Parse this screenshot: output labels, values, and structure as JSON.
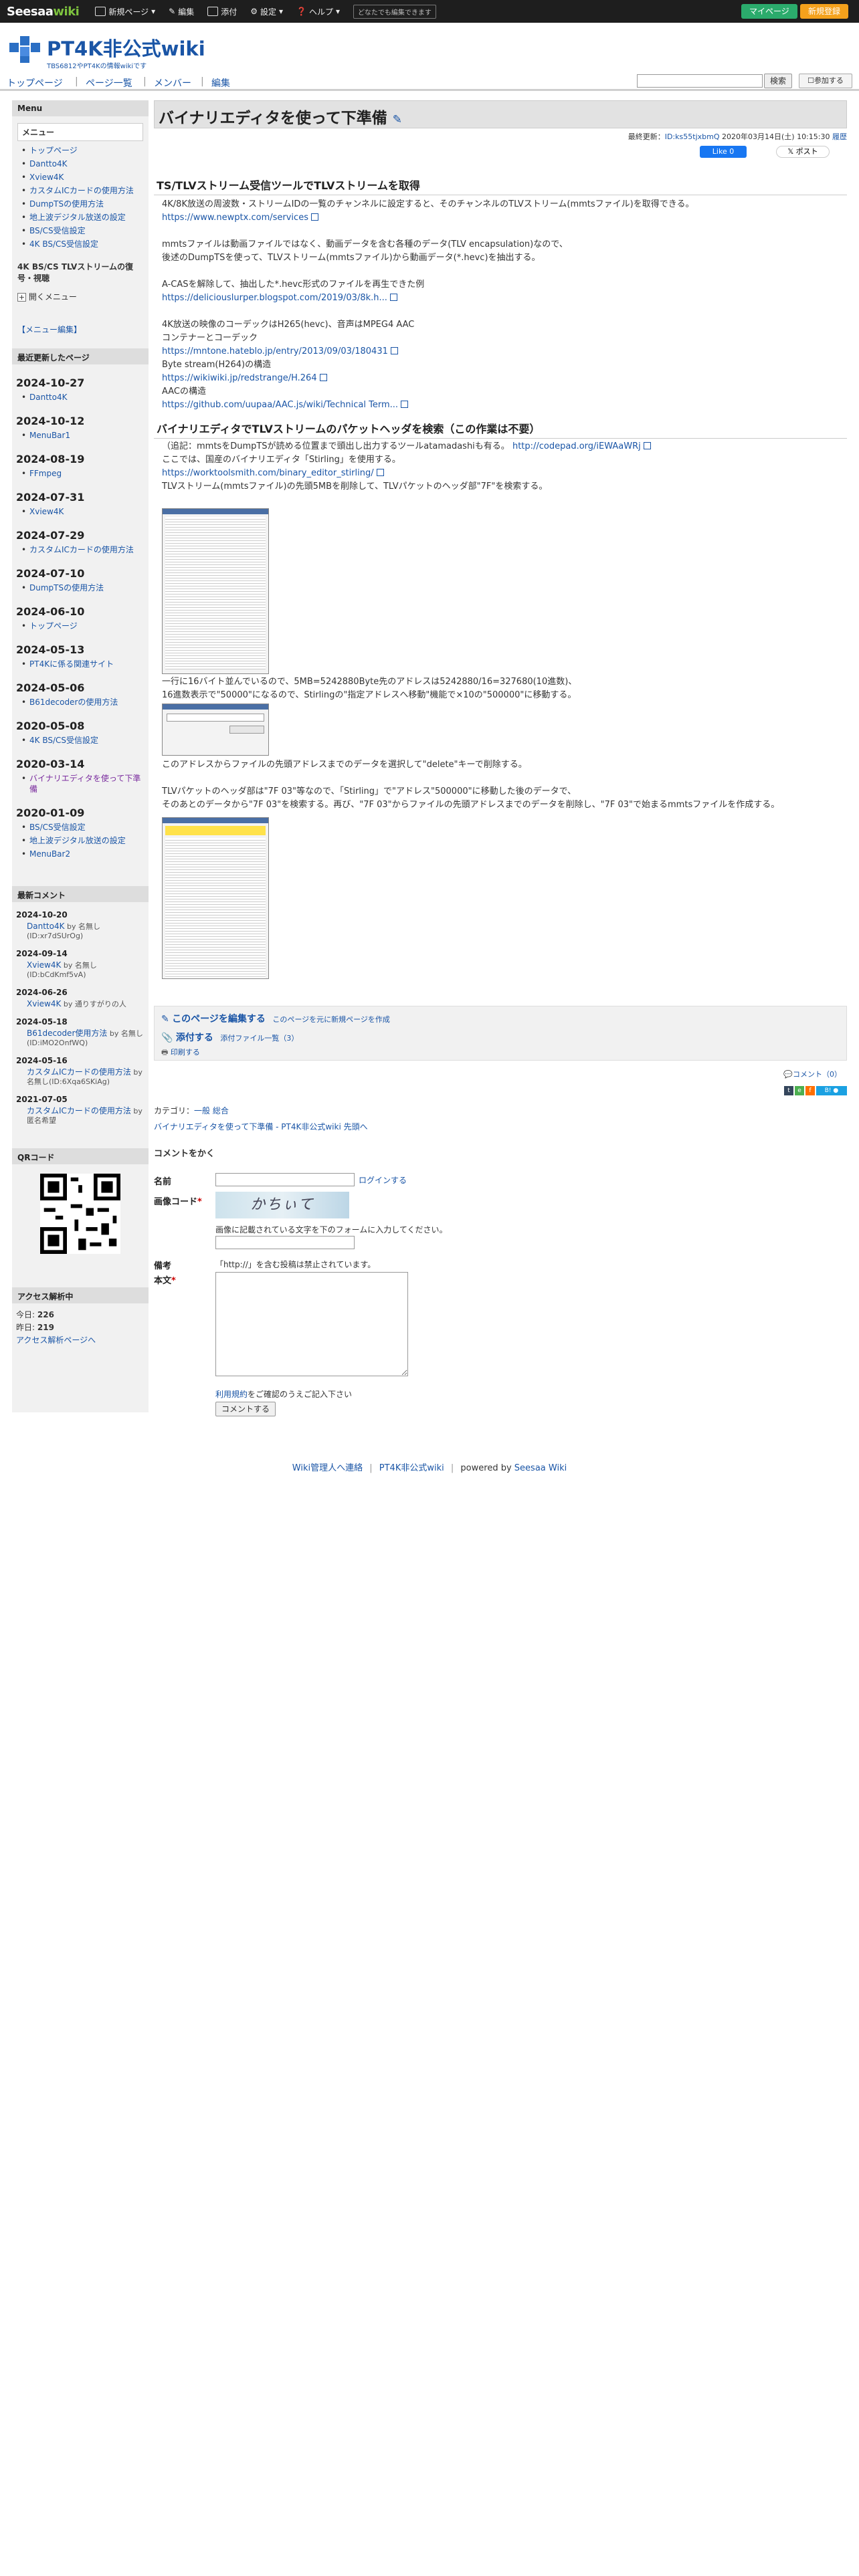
{
  "topbar": {
    "logo_a": "Seesaa",
    "logo_b": "wiki",
    "new_page": "新規ページ",
    "edit": "編集",
    "attach": "添付",
    "settings": "設定",
    "help": "ヘルプ",
    "note": "どなたでも編集できます",
    "mypage": "マイページ",
    "new_reg": "新規登録"
  },
  "site": {
    "name": "PT4K非公式wiki",
    "desc": "TBS6812やPT4Kの情報wikiです"
  },
  "gnav": {
    "top": "トップページ",
    "list": "ページ一覧",
    "member": "メンバー",
    "edit": "編集",
    "search_btn": "検索",
    "join_btn": "参加する"
  },
  "sidebar": {
    "menu_heading": "Menu",
    "menu_title": "メニュー",
    "menu_items": [
      "トップページ",
      "Dantto4K",
      "Xview4K",
      "カスタムICカードの使用方法",
      "DumpTSの使用方法",
      "地上波デジタル放送の設定",
      "BS/CS受信設定",
      "4K BS/CS受信設定"
    ],
    "sub_heading": "4K BS/CS TLVストリームの復号・視聴",
    "open_menu": "開くメニュー",
    "menu_edit": "【メニュー編集】",
    "recent_heading": "最近更新したページ",
    "recent": [
      {
        "date": "2024-10-27",
        "items": [
          "Dantto4K"
        ]
      },
      {
        "date": "2024-10-12",
        "items": [
          "MenuBar1"
        ]
      },
      {
        "date": "2024-08-19",
        "items": [
          "FFmpeg"
        ]
      },
      {
        "date": "2024-07-31",
        "items": [
          "Xview4K"
        ]
      },
      {
        "date": "2024-07-29",
        "items": [
          "カスタムICカードの使用方法"
        ]
      },
      {
        "date": "2024-07-10",
        "items": [
          "DumpTSの使用方法"
        ]
      },
      {
        "date": "2024-06-10",
        "items": [
          "トップページ"
        ]
      },
      {
        "date": "2024-05-13",
        "items": [
          "PT4Kに係る関連サイト"
        ]
      },
      {
        "date": "2024-05-06",
        "items": [
          "B61decoderの使用方法"
        ]
      },
      {
        "date": "2020-05-08",
        "items": [
          "4K BS/CS受信設定"
        ]
      },
      {
        "date": "2020-03-14",
        "items": [
          "バイナリエディタを使って下準備"
        ]
      },
      {
        "date": "2020-01-09",
        "items": [
          "BS/CS受信設定",
          "地上波デジタル放送の設定",
          "MenuBar2"
        ]
      }
    ],
    "comments_heading": "最新コメント",
    "comments": [
      {
        "date": "2024-10-20",
        "page": "Dantto4K",
        "by": "by 名無し(ID:xr7dSUrOg)"
      },
      {
        "date": "2024-09-14",
        "page": "Xview4K",
        "by": "by 名無し(ID:bCdKmf5vA)"
      },
      {
        "date": "2024-06-26",
        "page": "Xview4K",
        "by": "by 通りすがりの人"
      },
      {
        "date": "2024-05-18",
        "page": "B61decoder使用方法",
        "by": "by 名無し(ID:iMO2OnfWQ)"
      },
      {
        "date": "2024-05-16",
        "page": "カスタムICカードの使用方法",
        "by": "by 名無し(ID:6Xqa6SKiAg)"
      },
      {
        "date": "2021-07-05",
        "page": "カスタムICカードの使用方法",
        "by": "by 匿名希望"
      }
    ],
    "qr_heading": "QRコード",
    "access_heading": "アクセス解析中",
    "today_label": "今日:",
    "today": "226",
    "yesterday_label": "昨日:",
    "yesterday": "219",
    "access_link": "アクセス解析ページへ"
  },
  "page": {
    "title": "バイナリエディタを使って下準備",
    "meta_prefix": "最終更新：",
    "meta_id": "ID:ks55tjxbmQ",
    "meta_date": "2020年03月14日(土) 10:15:30",
    "meta_history": "履歴",
    "like": "Like 0",
    "post": "ポスト",
    "sec1_title": "TS/TLVストリーム受信ツールでTLVストリームを取得",
    "sec1_p1": "4K/8K放送の周波数・ストリームIDの一覧のチャンネルに設定すると、そのチャンネルのTLVストリーム(mmtsファイル)を取得できる。",
    "sec1_link1": "https://www.newptx.com/services",
    "sec1_p2": "mmtsファイルは動画ファイルではなく、動画データを含む各種のデータ(TLV encapsulation)なので、",
    "sec1_p3": "後述のDumpTSを使って、TLVストリーム(mmtsファイル)から動画データ(*.hevc)を抽出する。",
    "sec1_p4": "A-CASを解除して、抽出した*.hevc形式のファイルを再生できた例",
    "sec1_link2": "https://deliciouslurper.blogspot.com/2019/03/8k.h...",
    "sec1_p5": "4K放送の映像のコーデックはH265(hevc)、音声はMPEG4 AAC",
    "sec1_p6": "コンテナーとコーデック",
    "sec1_link3": "https://mntone.hateblo.jp/entry/2013/09/03/180431",
    "sec1_p7": "Byte stream(H264)の構造",
    "sec1_link4": "https://wikiwiki.jp/redstrange/H.264",
    "sec1_p8": "AACの構造",
    "sec1_link5": "https://github.com/uupaa/AAC.js/wiki/Technical Term...",
    "sec2_title": "バイナリエディタでTLVストリームのパケットヘッダを検索（この作業は不要）",
    "sec2_p1": "（追記：mmtsをDumpTSが読める位置まで頭出し出力するツールatamadashiも有る。",
    "sec2_link1": "http://codepad.org/iEWAaWRj",
    "sec2_p2": "ここでは、国産のバイナリエディタ「Stirling」を使用する。",
    "sec2_link2": "https://worktoolsmith.com/binary_editor_stirling/",
    "sec2_p3": "TLVストリーム(mmtsファイル)の先頭5MBを削除して、TLVパケットのヘッダ部\"7F\"を検索する。",
    "sec2_p4": "一行に16バイト並んでいるので、5MB=5242880Byte先のアドレスは5242880/16=327680(10進数)、",
    "sec2_p5": "16進数表示で\"50000\"になるので、Stirlingの\"指定アドレスへ移動\"機能で×10の\"500000\"に移動する。",
    "sec2_p6": "このアドレスからファイルの先頭アドレスまでのデータを選択して\"delete\"キーで削除する。",
    "sec2_p7": "TLVパケットのヘッダ部は\"7F 03\"等なので、「Stirling」で\"アドレス\"500000\"に移動した後のデータで、",
    "sec2_p8": "そのあとのデータから\"7F 03\"を検索する。再び、\"7F 03\"からファイルの先頭アドレスまでのデータを削除し、\"7F 03\"で始まるmmtsファイルを作成する。",
    "edit_this": "このページを編集する",
    "new_from": "このページを元に新規ページを作成",
    "attach": "添付する",
    "attach_list": "添付ファイル一覧（3）",
    "print": "印刷する",
    "comment_link": "コメント（0）",
    "category_label": "カテゴリ：",
    "category_a": "一般",
    "category_b": "総合",
    "backlink": "バイナリエディタを使って下準備 - PT4K非公式wiki 先頭へ",
    "form_title": "コメントをかく",
    "name_label": "名前",
    "login": "ログインする",
    "captcha_label": "画像コード",
    "captcha_text": "かちぃて",
    "captcha_hint": "画像に記載されている文字を下のフォームに入力してください。",
    "note_label": "備考",
    "note_text": "「http://」を含む投稿は禁止されています。",
    "body_label": "本文",
    "terms_a": "利用規約",
    "terms_b": "をご確認のうえご記入下さい",
    "submit": "コメントする"
  },
  "footer": {
    "contact": "Wiki管理人へ連絡",
    "site": "PT4K非公式wiki",
    "powered": "powered by",
    "seesaa": "Seesaa Wiki"
  },
  "colors": {
    "accent": "#1a55a6",
    "green": "#2bab6c",
    "orange": "#f4a11c"
  }
}
